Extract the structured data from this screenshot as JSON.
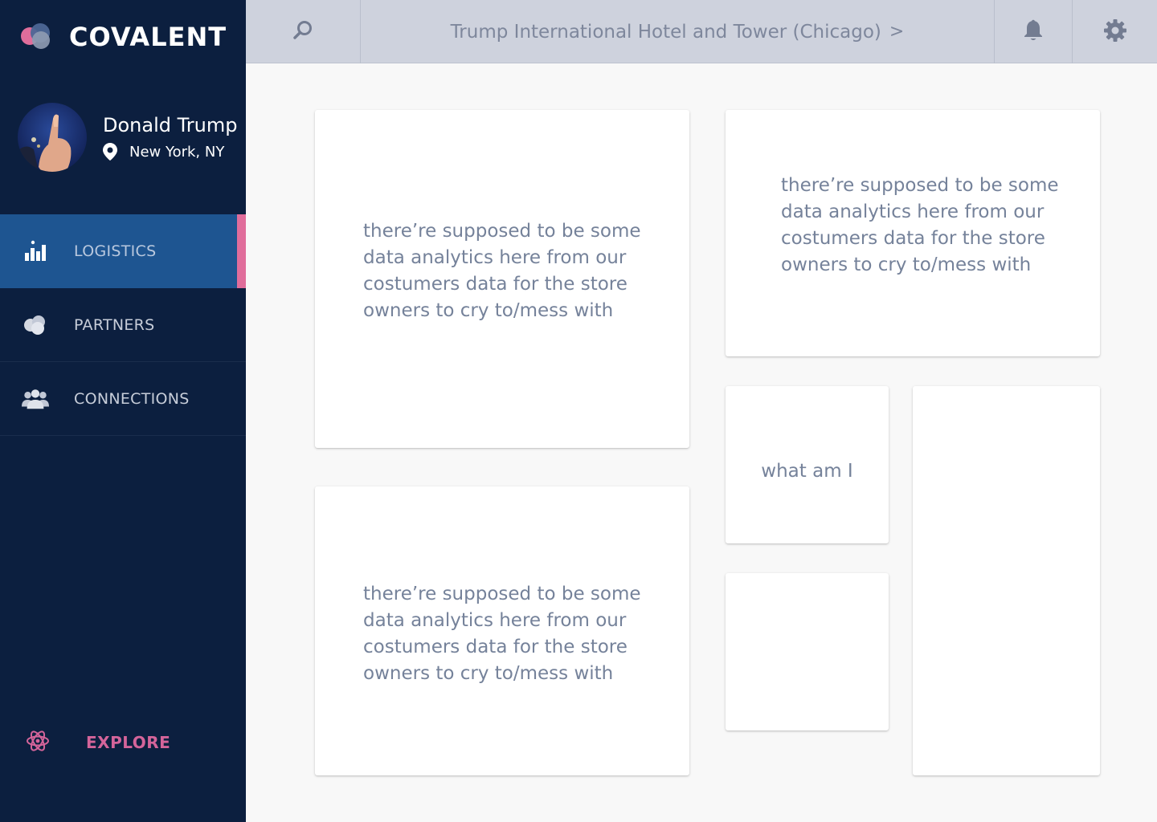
{
  "app": {
    "brand": "COVALENT",
    "colors": {
      "sidebar_bg": "#0c1f3f",
      "active_nav_bg": "#1e5591",
      "accent_pink": "#e06d9b",
      "topbar_bg": "#ced2dd",
      "card_text": "#75829a"
    }
  },
  "profile": {
    "name": "Donald Trump",
    "location": "New York, NY",
    "location_icon": "map-pin-icon"
  },
  "nav": {
    "items": [
      {
        "label": "LOGISTICS",
        "icon": "bar-chart-icon",
        "active": true
      },
      {
        "label": "PARTNERS",
        "icon": "overlapping-circles-icon",
        "active": false
      },
      {
        "label": "CONNECTIONS",
        "icon": "users-group-icon",
        "active": false
      }
    ],
    "explore": {
      "label": "EXPLORE",
      "icon": "atom-icon"
    }
  },
  "topbar": {
    "search_icon": "search-icon",
    "title": "Trump International Hotel and Tower (Chicago)",
    "title_chevron": ">",
    "bell_icon": "bell-icon",
    "settings_icon": "gear-icon"
  },
  "cards": [
    {
      "text": "there’re supposed to be some data analytics here from our costumers data for the store owners to cry to/mess with"
    },
    {
      "text": "there’re supposed to be some data analytics here from our costumers data for the store owners to cry to/mess with"
    },
    {
      "text": "there’re supposed to be some data analytics here from our costumers data for the store owners to cry to/mess with"
    },
    {
      "text": "what am I"
    },
    {
      "text": ""
    },
    {
      "text": ""
    }
  ]
}
